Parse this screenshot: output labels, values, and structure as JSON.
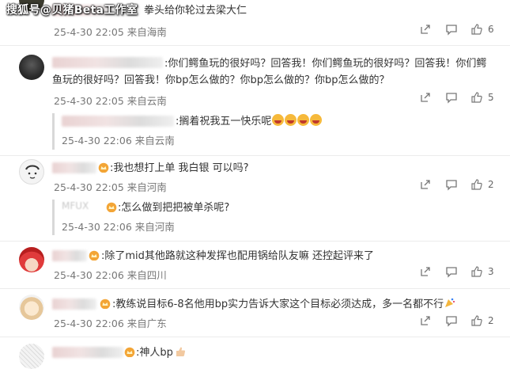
{
  "watermark": "搜狐号@贝猪Beta工作室",
  "comments": [
    {
      "text": "拳头给你轮过去梁大仁",
      "time": "25-4-30 22:05",
      "location": "来自海南",
      "likes": "6"
    },
    {
      "text": ":你们鳄鱼玩的很好吗？回答我！你们鳄鱼玩的很好吗？回答我！你们鳄鱼玩的很好吗？回答我！你bp怎么做的？你bp怎么做的？你bp怎么做的？",
      "line1": ":你们鳄鱼玩的很好吗？回答我！你们鳄鱼玩的很好吗？回答我！你们鳄",
      "line2": "鱼玩的很好吗？回答我！你bp怎么做的？你bp怎么做的？你bp怎么做的？",
      "time": "25-4-30 22:05",
      "location": "来自云南",
      "likes": "5",
      "reply": {
        "text": ":搁着祝我五一快乐呢",
        "time": "25-4-30 22:06",
        "location": "来自云南"
      }
    },
    {
      "text": ":我也想打上单  我白银 可以吗?",
      "time": "25-4-30 22:05",
      "location": "来自河南",
      "likes": "2",
      "reply": {
        "name_visible": "MFUX",
        "text": ":怎么做到把把被单杀呢?",
        "time": "25-4-30 22:06",
        "location": "来自河南"
      }
    },
    {
      "text": ":除了mid其他路就这种发挥也配用锅给队友嘛 还控起评来了",
      "time": "25-4-30 22:06",
      "location": "来自四川",
      "likes": "3"
    },
    {
      "text": ":教练说目标6-8名他用bp实力告诉大家这个目标必须达成，多一名都不行",
      "time": "25-4-30 22:06",
      "location": "来自广东",
      "likes": "2"
    },
    {
      "text": ":神人bp"
    }
  ],
  "icons": {
    "share": "share-icon",
    "comment": "comment-icon",
    "like": "thumbs-up-icon",
    "crown": "crown-badge-icon",
    "emoji": "grin-emoji-icon"
  }
}
